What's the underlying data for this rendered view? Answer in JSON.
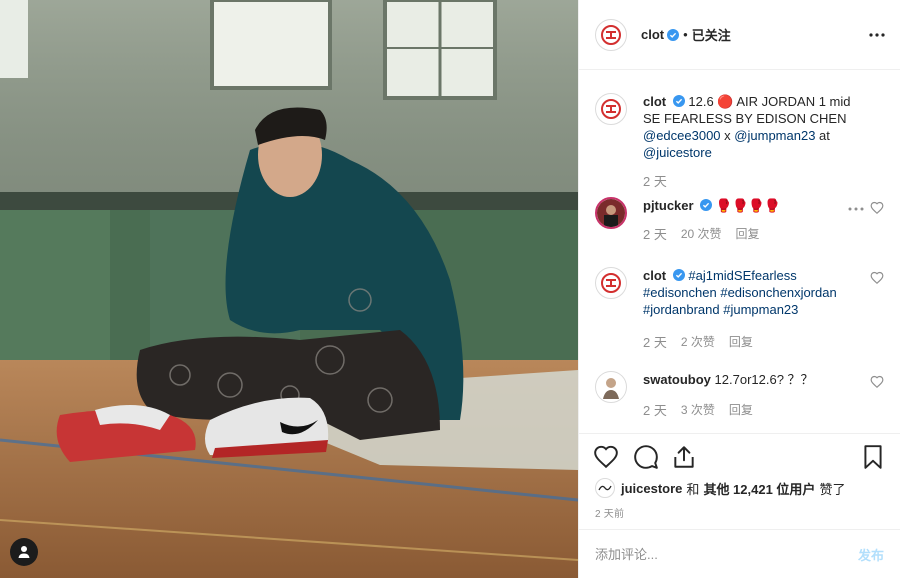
{
  "post": {
    "account": "clot",
    "follow_state": "已关注",
    "caption": "12.6 🔴 AIR JORDAN 1 mid SE FEARLESS BY EDISON CHEN",
    "caption_tags": [
      "@edcee3000",
      "x",
      "@jumpman23",
      "at",
      "@juicestore"
    ],
    "caption_time": "2 天"
  },
  "comments": [
    {
      "user": "pjtucker",
      "text": "🥊🥊🥊🥊",
      "time": "2 天",
      "likes": "20 次赞",
      "reply": "回复"
    },
    {
      "user": "clot",
      "text": "#aj1midSEfearless #edisonchen #edisonchenxjordan #jordanbrand #jumpman23",
      "time": "2 天",
      "likes": "2 次赞",
      "reply": "回复"
    },
    {
      "user": "swatouboy",
      "text": "12.7or12.6? ？？",
      "time": "2 天",
      "likes": "3 次赞",
      "reply": "回复"
    }
  ],
  "liked_by": {
    "user": "juicestore",
    "joiner": "和",
    "others": "其他 12,421 位用户",
    "suffix": "赞了"
  },
  "post_time": "2 天前",
  "add_comment": {
    "placeholder": "添加评论...",
    "post_label": "发布"
  },
  "colors": {
    "verified": "#3897f0",
    "brand_red": "#d32f2f",
    "link": "#00376b",
    "muted": "#8e8e8e",
    "post_button": "#b2dffc"
  },
  "icons": [
    "verified-badge-icon",
    "more-options-icon",
    "heart-icon",
    "comment-icon",
    "share-icon",
    "bookmark-icon",
    "user-tag-icon"
  ]
}
